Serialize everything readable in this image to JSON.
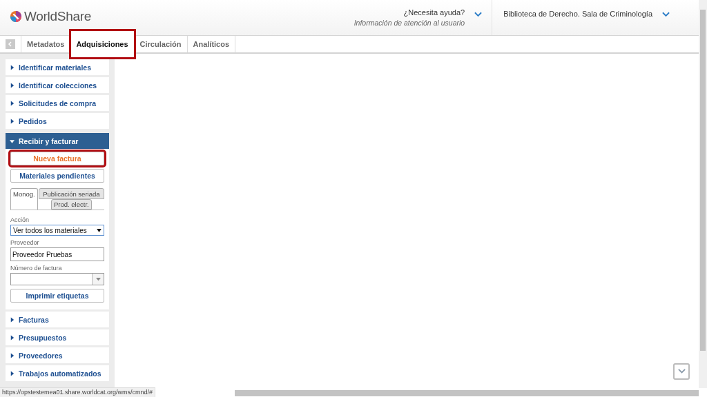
{
  "header": {
    "logo": "WorldShare",
    "help": {
      "title": "¿Necesita ayuda?",
      "subtitle": "Información de atención al usuario"
    },
    "institution": "Biblioteca de Derecho. Sala de Criminología"
  },
  "tabs": [
    {
      "label": "Metadatos",
      "selected": false,
      "highlighted": false
    },
    {
      "label": "Adquisiciones",
      "selected": true,
      "highlighted": true
    },
    {
      "label": "Circulación",
      "selected": false,
      "highlighted": false
    },
    {
      "label": "Analíticos",
      "selected": false,
      "highlighted": false
    }
  ],
  "sidebar": {
    "sections": [
      {
        "label": "Identificar materiales",
        "expanded": false
      },
      {
        "label": "Identificar colecciones",
        "expanded": false
      },
      {
        "label": "Solicitudes de compra",
        "expanded": false
      },
      {
        "label": "Pedidos",
        "expanded": false
      },
      {
        "label": "Recibir y facturar",
        "expanded": true,
        "panel": {
          "buttons": [
            {
              "label": "Nueva factura",
              "highlighted": true
            },
            {
              "label": "Materiales pendientes",
              "highlighted": false
            }
          ],
          "subtabs": [
            {
              "label": "Monog.",
              "selected": true
            },
            {
              "label": "Publicación seriada",
              "selected": false
            },
            {
              "label": "Prod. electr.",
              "selected": false
            }
          ],
          "action": {
            "label": "Acción",
            "value": "Ver todos los materiales"
          },
          "vendor": {
            "label": "Proveedor",
            "value": "Proveedor Pruebas"
          },
          "invoice_number": {
            "label": "Número de factura"
          },
          "print_button": "Imprimir etiquetas"
        }
      },
      {
        "label": "Facturas",
        "expanded": false
      },
      {
        "label": "Presupuestos",
        "expanded": false
      },
      {
        "label": "Proveedores",
        "expanded": false
      },
      {
        "label": "Trabajos automatizados",
        "expanded": false
      }
    ]
  },
  "status_bar": {
    "url": "https://opstestemea01.share.worldcat.org/wms/cmnd/#"
  }
}
